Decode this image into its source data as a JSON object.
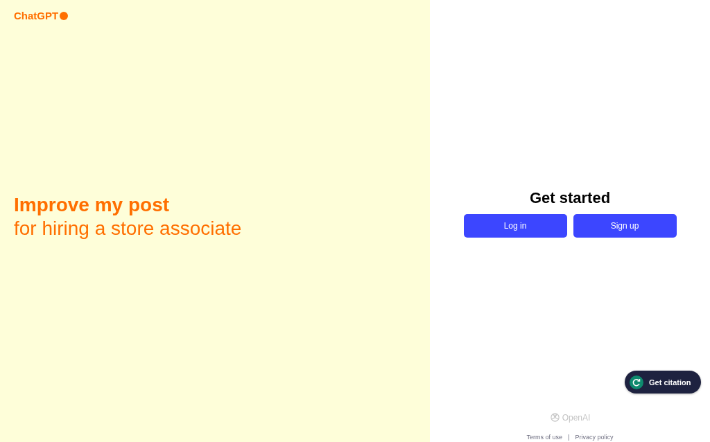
{
  "brand": {
    "name": "ChatGPT"
  },
  "hero": {
    "headline": "Improve my post",
    "subline": "for hiring a store associate"
  },
  "auth": {
    "title": "Get started",
    "buttons": [
      "Log in",
      "Sign up"
    ]
  },
  "widget": {
    "label": "Get citation"
  },
  "footer": {
    "company": "OpenAI",
    "links": [
      "Terms of use",
      "Privacy policy"
    ],
    "separator": "|"
  }
}
